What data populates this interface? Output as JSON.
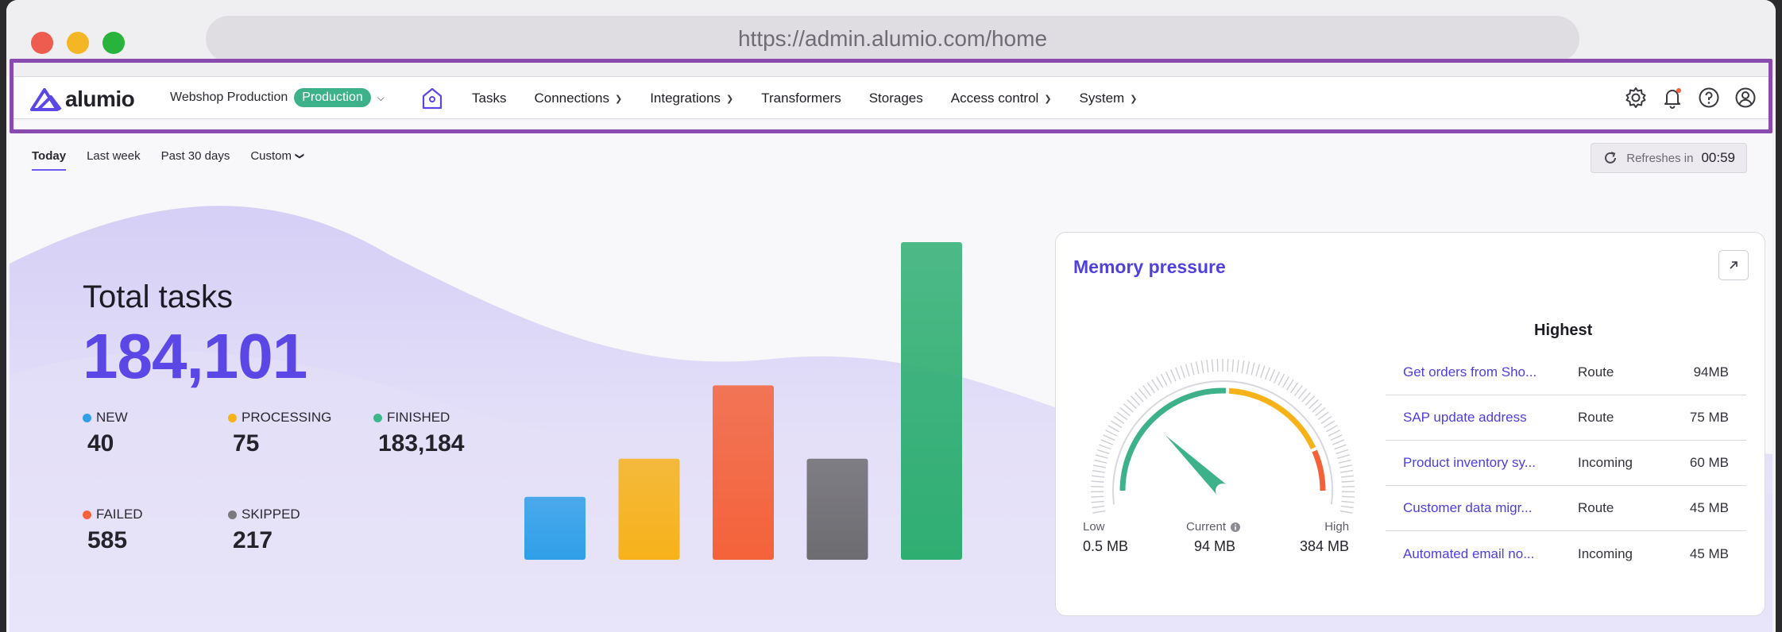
{
  "browser": {
    "url": "https://admin.alumio.com/home"
  },
  "nav": {
    "logo_text": "alumio",
    "environment_name": "Webshop Production",
    "environment_badge": "Production",
    "items": [
      {
        "label": "Tasks",
        "dropdown": false
      },
      {
        "label": "Connections",
        "dropdown": true
      },
      {
        "label": "Integrations",
        "dropdown": true
      },
      {
        "label": "Transformers",
        "dropdown": false
      },
      {
        "label": "Storages",
        "dropdown": false
      },
      {
        "label": "Access control",
        "dropdown": true
      },
      {
        "label": "System",
        "dropdown": true
      }
    ],
    "icons": [
      "gear-icon",
      "bell-icon",
      "help-icon",
      "user-icon"
    ]
  },
  "tabs": {
    "today": "Today",
    "last_week": "Last week",
    "past_30": "Past 30 days",
    "custom": "Custom",
    "active": "Today"
  },
  "refresh": {
    "label": "Refreshes in",
    "time": "00:59"
  },
  "totals": {
    "title": "Total tasks",
    "value": "184,101",
    "stats": [
      {
        "key": "new",
        "label": "NEW",
        "value": "40",
        "color": "#2f9fe8"
      },
      {
        "key": "processing",
        "label": "PROCESSING",
        "value": "75",
        "color": "#f7b21a"
      },
      {
        "key": "finished",
        "label": "FINISHED",
        "value": "183,184",
        "color": "#3eb68c"
      },
      {
        "key": "failed",
        "label": "FAILED",
        "value": "585",
        "color": "#f4623a"
      },
      {
        "key": "skipped",
        "label": "SKIPPED",
        "value": "217",
        "color": "#7a797e"
      }
    ]
  },
  "chart_data": {
    "type": "bar",
    "categories": [
      "NEW",
      "PROCESSING",
      "FAILED",
      "SKIPPED",
      "FINISHED"
    ],
    "relative_heights": [
      0.198,
      0.318,
      0.549,
      0.318,
      1.0
    ],
    "colors": [
      "#2f9fe8",
      "#f7b21a",
      "#f4623a",
      "#6d6c70",
      "#2fae72"
    ]
  },
  "memory": {
    "title": "Memory pressure",
    "gauge": {
      "low_label": "Low",
      "low_value": "0.5 MB",
      "current_label": "Current",
      "current_value": "94 MB",
      "high_label": "High",
      "high_value": "384 MB",
      "current_fraction": 0.245
    },
    "highest_title": "Highest",
    "rows": [
      {
        "name": "Get orders from Sho...",
        "type": "Route",
        "size": "94MB"
      },
      {
        "name": "SAP update address",
        "type": "Route",
        "size": "75 MB"
      },
      {
        "name": "Product inventory sy...",
        "type": "Incoming",
        "size": "60 MB"
      },
      {
        "name": "Customer data migr...",
        "type": "Route",
        "size": "45 MB"
      },
      {
        "name": "Automated email no...",
        "type": "Incoming",
        "size": "45 MB"
      }
    ]
  }
}
